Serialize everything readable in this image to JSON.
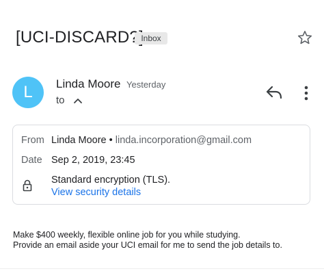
{
  "header": {
    "subject": "[UCI-DISCARD?]",
    "label_badge": "Inbox",
    "star_icon": "star-outline-icon"
  },
  "sender": {
    "avatar_initial": "L",
    "avatar_color": "#4fc3f7",
    "name": "Linda Moore",
    "date": "Yesterday",
    "to_label": "to",
    "chevron_icon": "chevron-up-icon",
    "reply_icon": "reply-icon",
    "more_icon": "more-vert-icon"
  },
  "details": {
    "from_label": "From",
    "from_name": "Linda Moore",
    "from_separator": "•",
    "from_email": "linda.incorporation@gmail.com",
    "date_label": "Date",
    "date_value": "Sep 2, 2019, 23:45",
    "lock_icon": "lock-icon",
    "encryption": "Standard encryption (TLS).",
    "security_link": "View security details",
    "link_color": "#1a73e8"
  },
  "message": {
    "line1": "Make $400 weekly, flexible online job for you while studying.",
    "line2": "Provide an email aside your UCI email for me to send the job details to."
  }
}
